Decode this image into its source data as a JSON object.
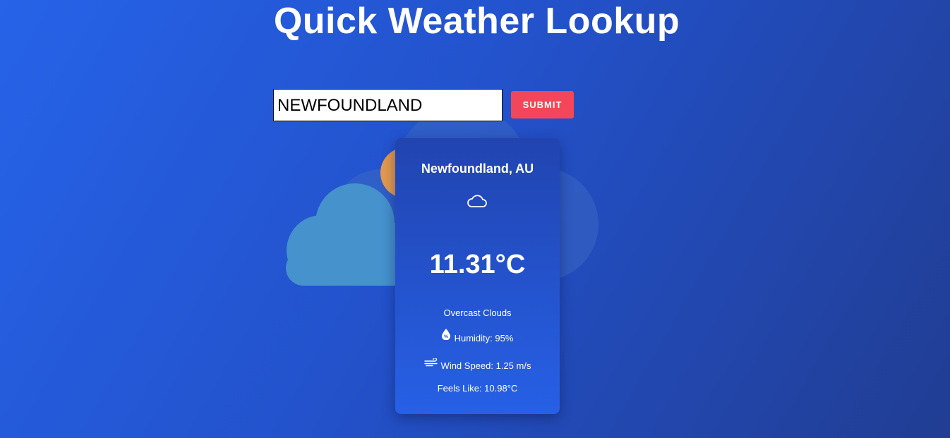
{
  "header": {
    "title": "Quick Weather Lookup"
  },
  "search": {
    "value": "NEWFOUNDLAND",
    "submit_label": "SUBMIT"
  },
  "weather": {
    "location": "Newfoundland, AU",
    "condition_icon": "cloud-icon",
    "temperature": "11.31°C",
    "description": "Overcast Clouds",
    "humidity": "Humidity: 95%",
    "humidity_icon": "humidity-drop-icon",
    "wind": "Wind Speed: 1.25 m/s",
    "wind_icon": "wind-icon",
    "feels_like": "Feels Like: 10.98°C"
  },
  "colors": {
    "background_start": "#2663e8",
    "background_end": "#213d93",
    "submit_button": "#f4465a",
    "card_top": "#2144b0",
    "card_bottom": "#2760e6"
  }
}
